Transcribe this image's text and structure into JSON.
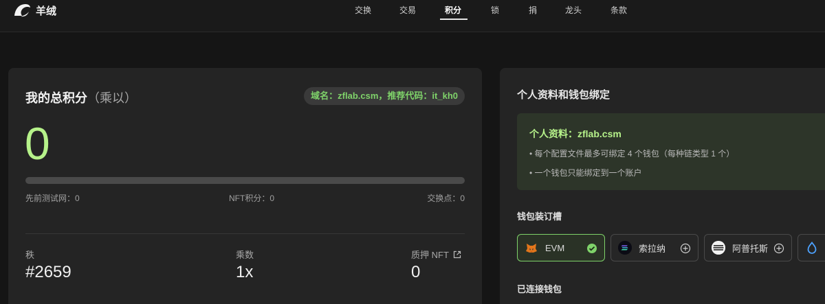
{
  "brand": {
    "name": "羊绒"
  },
  "nav": {
    "items": [
      {
        "label": "交换"
      },
      {
        "label": "交易"
      },
      {
        "label": "积分"
      },
      {
        "label": "锁"
      },
      {
        "label": "捐"
      },
      {
        "label": "龙头"
      },
      {
        "label": "条款"
      }
    ],
    "active": "积分"
  },
  "points": {
    "title": "我的总积分",
    "subtitle": "（乘以）",
    "badge": "域名：zflab.csm，推荐代码：it_kh0",
    "total": "0",
    "progress_fraction": 0,
    "stats": {
      "testnet": "先前测试网：0",
      "nft": "NFT积分：0",
      "swap": "交换点：0"
    },
    "rank": {
      "label": "秩",
      "value": "#2659"
    },
    "multiplier": {
      "label": "乘数",
      "value": "1x"
    },
    "staked": {
      "label": "质押 NFT",
      "value": "0"
    }
  },
  "profile": {
    "section_title": "个人资料和钱包绑定",
    "name_line": "个人资料：zflab.csm",
    "notes": [
      "• 每个配置文件最多可绑定 4 个钱包（每种链类型 1 个）",
      "• 一个钱包只能绑定到一个账户"
    ],
    "slots_title": "钱包装订槽",
    "slots": [
      {
        "label": "EVM",
        "icon": "metamask-fox-icon",
        "status": "bound"
      },
      {
        "label": "索拉纳",
        "icon": "solana-icon",
        "status": "add"
      },
      {
        "label": "阿普托斯",
        "icon": "aptos-icon",
        "status": "add"
      },
      {
        "label": "",
        "icon": "sui-icon",
        "status": "add"
      }
    ],
    "connected_title": "已连接钱包"
  },
  "colors": {
    "accent_green": "#b6f28a",
    "badge_green": "#7fd36a",
    "background": "#151515",
    "card": "#242424"
  }
}
